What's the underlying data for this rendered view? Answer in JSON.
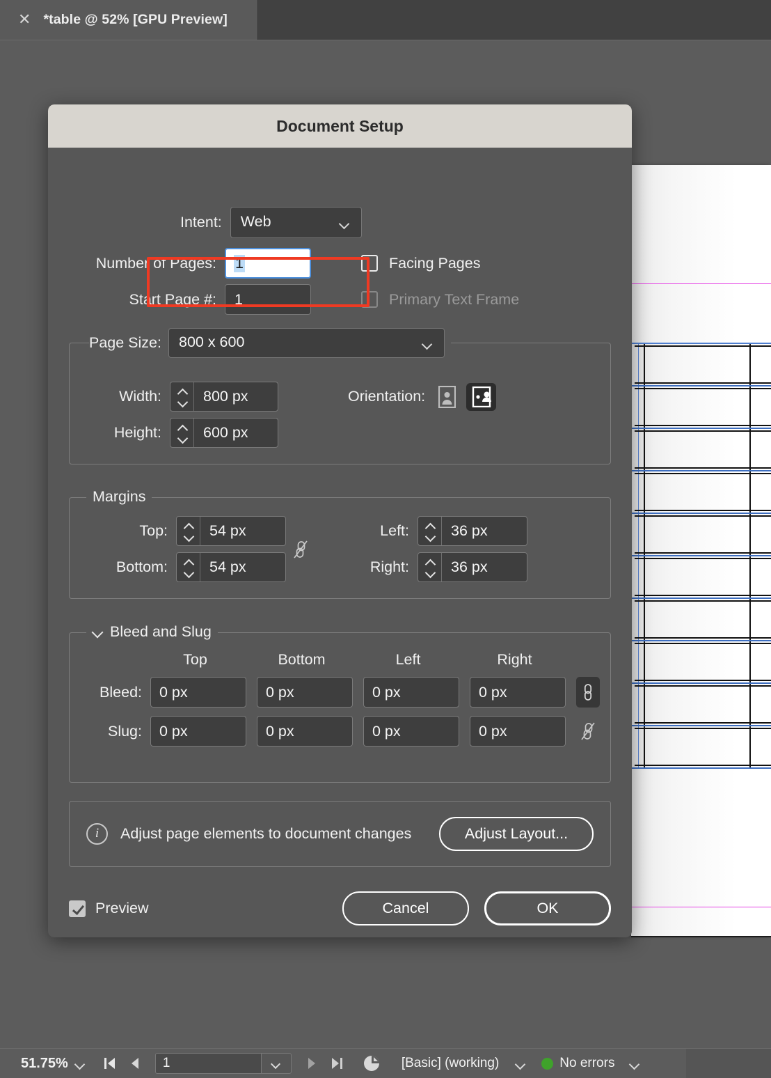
{
  "window": {
    "tab_title": "*table @ 52% [GPU Preview]",
    "close_icon": "close-icon"
  },
  "dialog": {
    "title": "Document Setup",
    "intent": {
      "label": "Intent:",
      "value": "Web"
    },
    "number_of_pages": {
      "label": "Number of Pages:",
      "value": "1"
    },
    "start_page": {
      "label": "Start Page #:",
      "value": "1"
    },
    "facing_pages": {
      "label": "Facing Pages",
      "checked": false
    },
    "primary_text_frame": {
      "label": "Primary Text Frame",
      "checked": false,
      "disabled": true
    },
    "page_size": {
      "legend": "",
      "label": "Page Size:",
      "value": "800 x 600",
      "width": {
        "label": "Width:",
        "value": "800 px"
      },
      "height": {
        "label": "Height:",
        "value": "600 px"
      },
      "orientation": {
        "label": "Orientation:",
        "portrait_icon": "portrait-orientation-icon",
        "landscape_icon": "landscape-orientation-icon",
        "selected": "landscape"
      }
    },
    "margins": {
      "legend": "Margins",
      "top": {
        "label": "Top:",
        "value": "54 px"
      },
      "bottom": {
        "label": "Bottom:",
        "value": "54 px"
      },
      "left": {
        "label": "Left:",
        "value": "36 px"
      },
      "right": {
        "label": "Right:",
        "value": "36 px"
      },
      "link_icon": "broken-chain-link-icon",
      "linked": false
    },
    "bleed_and_slug": {
      "legend": "Bleed and Slug",
      "columns": [
        "Top",
        "Bottom",
        "Left",
        "Right"
      ],
      "bleed": {
        "label": "Bleed:",
        "values": [
          "0 px",
          "0 px",
          "0 px",
          "0 px"
        ],
        "link_icon": "chain-link-icon",
        "linked": true
      },
      "slug": {
        "label": "Slug:",
        "values": [
          "0 px",
          "0 px",
          "0 px",
          "0 px"
        ],
        "link_icon": "broken-chain-link-icon",
        "linked": false
      }
    },
    "adjust_layout": {
      "info_icon": "info-icon",
      "text": "Adjust page elements to document changes",
      "button_label": "Adjust Layout..."
    },
    "preview": {
      "label": "Preview",
      "checked": true
    },
    "cancel_label": "Cancel",
    "ok_label": "OK",
    "highlight_color": "#ef3a23"
  },
  "statusbar": {
    "zoom": "51.75%",
    "page_number": "1",
    "first_page_icon": "first-page-icon",
    "prev_page_icon": "previous-page-icon",
    "next_page_icon": "next-page-icon",
    "last_page_icon": "last-page-icon",
    "page_tool_icon": "page-tool-icon",
    "preflight_profile": "[Basic] (working)",
    "errors": "No errors",
    "error_status_color": "#3fa22b"
  }
}
